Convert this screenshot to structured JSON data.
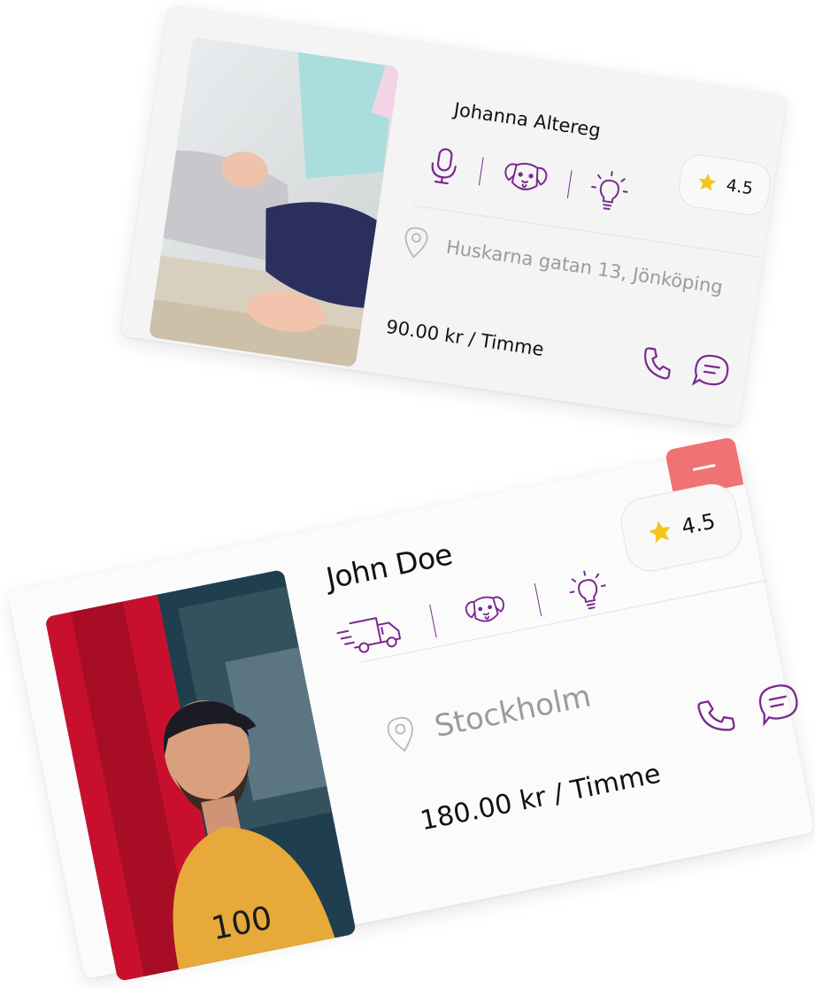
{
  "colors": {
    "accent": "#7a2a8f",
    "star": "#f5c518",
    "remove_button": "#f07272",
    "muted_text": "#9b9b9b"
  },
  "cards": [
    {
      "name": "Johanna Altereg",
      "rating": "4.5",
      "services": [
        "microphone-icon",
        "dog-icon",
        "lightbulb-icon"
      ],
      "location": "Huskarna gatan 13, Jönköping",
      "price": "90.00 kr / Timme",
      "photo": "woman-yoga-photo",
      "actions": [
        "phone-icon",
        "chat-icon"
      ]
    },
    {
      "name": "John Doe",
      "rating": "4.5",
      "services": [
        "delivery-truck-icon",
        "dog-icon",
        "lightbulb-icon"
      ],
      "location": "Stockholm",
      "price": "180.00 kr / Timme",
      "photo": "man-cap-photo",
      "actions": [
        "phone-icon",
        "chat-icon"
      ],
      "remove_button": "minus-icon"
    }
  ]
}
